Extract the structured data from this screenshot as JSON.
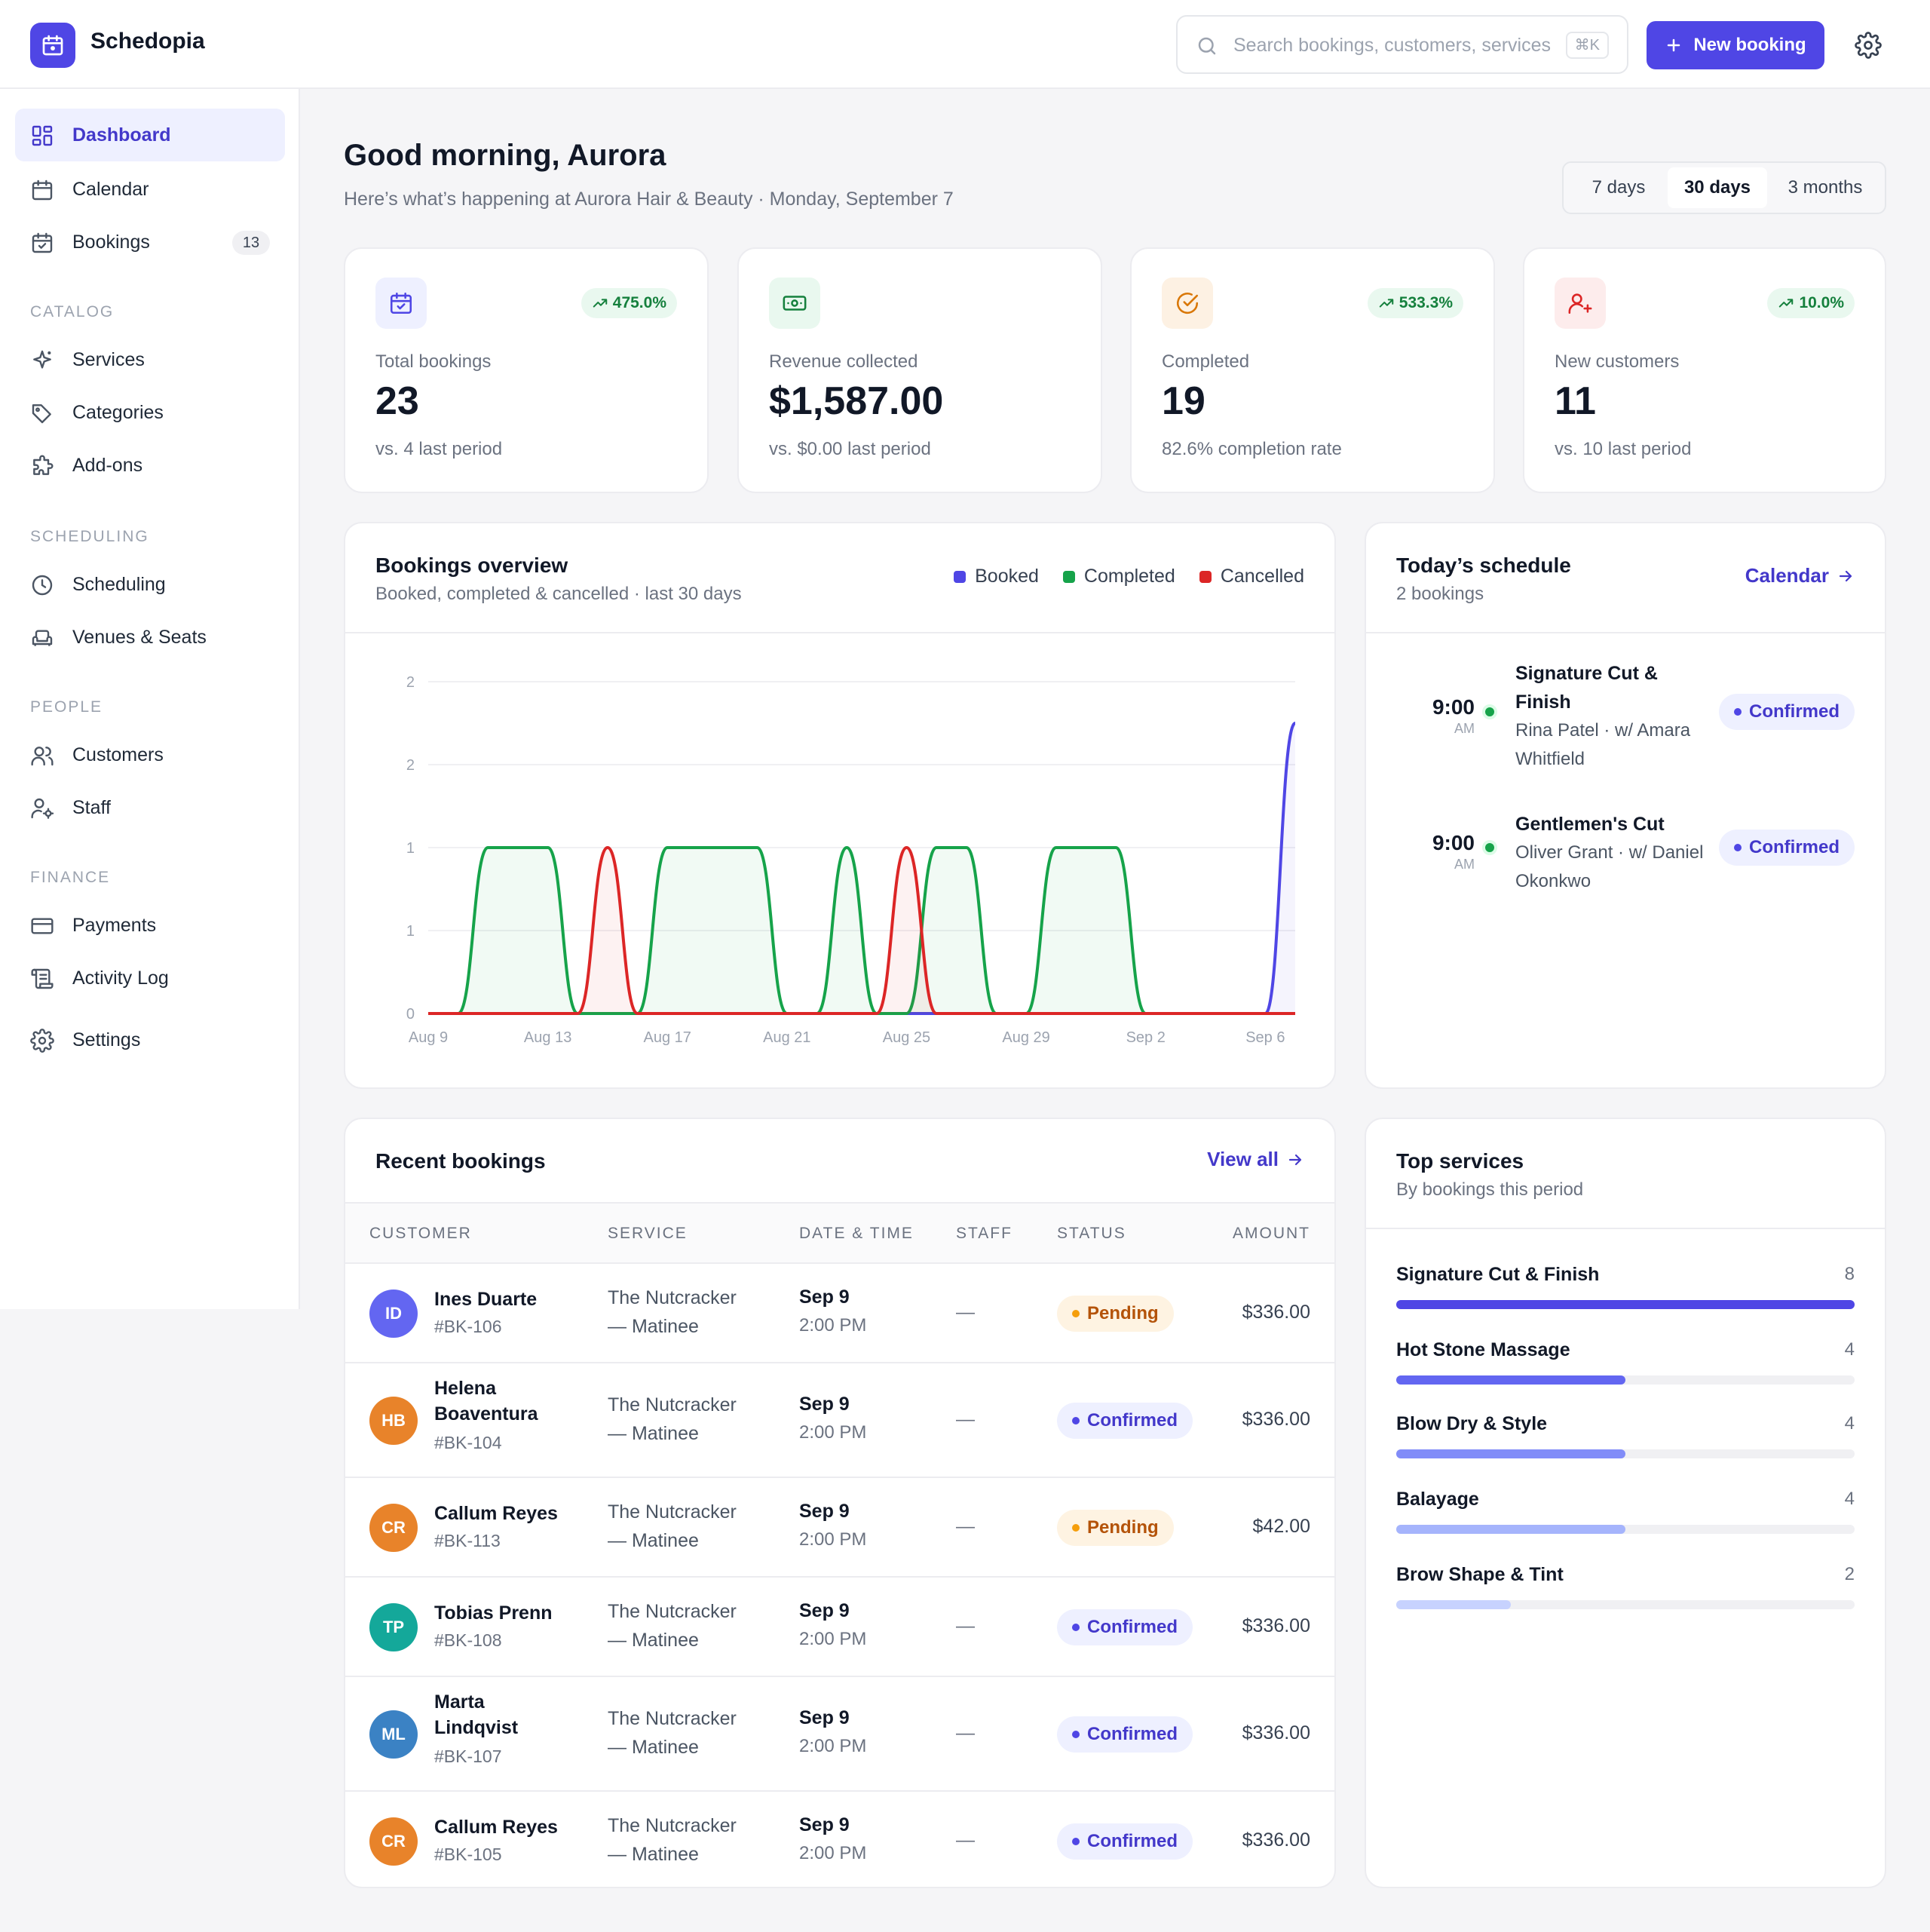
{
  "app": {
    "name": "Schedopia"
  },
  "header": {
    "search_placeholder": "Search bookings, customers, services",
    "shortcut": "⌘K",
    "new_booking": "New booking"
  },
  "sidebar": {
    "items": [
      {
        "label": "Dashboard",
        "icon": "dashboard-icon",
        "active": true
      },
      {
        "label": "Calendar",
        "icon": "calendar-icon"
      },
      {
        "label": "Bookings",
        "icon": "bookings-icon",
        "badge": "13"
      }
    ],
    "catalog": {
      "title": "CATALOG",
      "items": [
        {
          "label": "Services",
          "icon": "sparkle-icon"
        },
        {
          "label": "Categories",
          "icon": "tag-icon"
        },
        {
          "label": "Add-ons",
          "icon": "puzzle-icon"
        }
      ]
    },
    "scheduling": {
      "title": "SCHEDULING",
      "items": [
        {
          "label": "Scheduling",
          "icon": "clock-icon"
        },
        {
          "label": "Venues & Seats",
          "icon": "armchair-icon"
        }
      ]
    },
    "people": {
      "title": "PEOPLE",
      "items": [
        {
          "label": "Customers",
          "icon": "users-icon"
        },
        {
          "label": "Staff",
          "icon": "staff-icon"
        }
      ]
    },
    "finance": {
      "title": "FINANCE",
      "items": [
        {
          "label": "Payments",
          "icon": "credit-card-icon"
        },
        {
          "label": "Activity Log",
          "icon": "scroll-icon"
        }
      ]
    },
    "settings": {
      "label": "Settings",
      "icon": "gear-icon"
    }
  },
  "page": {
    "greeting": "Good morning, Aurora",
    "subtitle": "Here’s what’s happening at Aurora Hair & Beauty · Monday, September 7"
  },
  "range": {
    "options": [
      "7 days",
      "30 days",
      "3 months"
    ],
    "selected": "30 days"
  },
  "kpis": [
    {
      "label": "Total bookings",
      "value": "23",
      "sub": "vs. 4 last period",
      "trend": "475.0%",
      "icon": "calendar-check-icon",
      "icon_bg": "#eef0ff",
      "icon_color": "#4f46e5"
    },
    {
      "label": "Revenue collected",
      "value": "$1,587.00",
      "sub": "vs. $0.00 last period",
      "icon": "banknote-icon",
      "icon_bg": "#e9f8ef",
      "icon_color": "#15803d"
    },
    {
      "label": "Completed",
      "value": "19",
      "sub": "82.6% completion rate",
      "trend": "533.3%",
      "icon": "check-circle-icon",
      "icon_bg": "#fdf1e3",
      "icon_color": "#d97706"
    },
    {
      "label": "New customers",
      "value": "11",
      "sub": "vs. 10 last period",
      "trend": "10.0%",
      "icon": "user-plus-icon",
      "icon_bg": "#fdecec",
      "icon_color": "#dc2626"
    }
  ],
  "overview": {
    "title": "Bookings overview",
    "subtitle": "Booked, completed & cancelled · last 30 days",
    "legend": [
      {
        "name": "Booked",
        "color": "#4f46e5"
      },
      {
        "name": "Completed",
        "color": "#16a34a"
      },
      {
        "name": "Cancelled",
        "color": "#dc2626"
      }
    ]
  },
  "chart_data": {
    "type": "area",
    "x": [
      "Aug 9",
      "Aug 10",
      "Aug 11",
      "Aug 12",
      "Aug 13",
      "Aug 14",
      "Aug 15",
      "Aug 16",
      "Aug 17",
      "Aug 18",
      "Aug 19",
      "Aug 20",
      "Aug 21",
      "Aug 22",
      "Aug 23",
      "Aug 24",
      "Aug 25",
      "Aug 26",
      "Aug 27",
      "Aug 28",
      "Aug 29",
      "Aug 30",
      "Aug 31",
      "Sep 1",
      "Sep 2",
      "Sep 3",
      "Sep 4",
      "Sep 5",
      "Sep 6",
      "Sep 7"
    ],
    "x_ticks": [
      "Aug 9",
      "Aug 13",
      "Aug 17",
      "Aug 21",
      "Aug 25",
      "Aug 29",
      "Sep 2",
      "Sep 6"
    ],
    "y_ticks": [
      "0",
      "1",
      "1",
      "2",
      "2"
    ],
    "ylim": [
      0,
      2
    ],
    "series": [
      {
        "name": "Booked",
        "color": "#4f46e5",
        "values": [
          0,
          0,
          0,
          0,
          0,
          0,
          0,
          0,
          0,
          0,
          0,
          0,
          0,
          0,
          0,
          0,
          0,
          0,
          0,
          0,
          0,
          0,
          0,
          0,
          0,
          0,
          0,
          0,
          0,
          1.75
        ]
      },
      {
        "name": "Completed",
        "color": "#16a34a",
        "values": [
          0,
          0,
          1,
          1,
          1,
          0,
          0,
          0,
          1,
          1,
          1,
          1,
          0,
          0,
          1,
          0,
          0,
          1,
          1,
          0,
          0,
          1,
          1,
          1,
          0,
          0,
          0,
          0,
          0,
          0
        ]
      },
      {
        "name": "Cancelled",
        "color": "#dc2626",
        "values": [
          0,
          0,
          0,
          0,
          0,
          0,
          1,
          0,
          0,
          0,
          0,
          0,
          0,
          0,
          0,
          0,
          1,
          0,
          0,
          0,
          0,
          0,
          0,
          0,
          0,
          0,
          0,
          0,
          0,
          0
        ]
      }
    ]
  },
  "schedule": {
    "title": "Today’s schedule",
    "subtitle": "2 bookings",
    "link": "Calendar",
    "items": [
      {
        "time": "9:00",
        "ampm": "AM",
        "service": "Signature Cut & Finish",
        "who": "Rina Patel · w/ Amara Whitfield",
        "status": "Confirmed"
      },
      {
        "time": "9:00",
        "ampm": "AM",
        "service": "Gentlemen's Cut",
        "who": "Oliver Grant · w/ Daniel Okonkwo",
        "status": "Confirmed"
      }
    ]
  },
  "recent": {
    "title": "Recent bookings",
    "link": "View all",
    "columns": [
      "CUSTOMER",
      "SERVICE",
      "DATE & TIME",
      "STAFF",
      "STATUS",
      "AMOUNT"
    ],
    "rows": [
      {
        "initials": "ID",
        "color": "#6366f1",
        "name": "Ines Duarte",
        "id": "#BK-106",
        "service": "The Nutcracker — Matinee",
        "date": "Sep 9",
        "time": "2:00 PM",
        "staff": "—",
        "status": "Pending",
        "amount": "$336.00"
      },
      {
        "initials": "HB",
        "color": "#e8832a",
        "name": "Helena Boaventura",
        "id": "#BK-104",
        "service": "The Nutcracker — Matinee",
        "date": "Sep 9",
        "time": "2:00 PM",
        "staff": "—",
        "status": "Confirmed",
        "amount": "$336.00"
      },
      {
        "initials": "CR",
        "color": "#e8832a",
        "name": "Callum Reyes",
        "id": "#BK-113",
        "service": "The Nutcracker — Matinee",
        "date": "Sep 9",
        "time": "2:00 PM",
        "staff": "—",
        "status": "Pending",
        "amount": "$42.00"
      },
      {
        "initials": "TP",
        "color": "#14a89a",
        "name": "Tobias Prenn",
        "id": "#BK-108",
        "service": "The Nutcracker — Matinee",
        "date": "Sep 9",
        "time": "2:00 PM",
        "staff": "—",
        "status": "Confirmed",
        "amount": "$336.00"
      },
      {
        "initials": "ML",
        "color": "#3b82c4",
        "name": "Marta Lindqvist",
        "id": "#BK-107",
        "service": "The Nutcracker — Matinee",
        "date": "Sep 9",
        "time": "2:00 PM",
        "staff": "—",
        "status": "Confirmed",
        "amount": "$336.00"
      },
      {
        "initials": "CR",
        "color": "#e8832a",
        "name": "Callum Reyes",
        "id": "#BK-105",
        "service": "The Nutcracker — Matinee",
        "date": "Sep 9",
        "time": "2:00 PM",
        "staff": "—",
        "status": "Confirmed",
        "amount": "$336.00"
      }
    ]
  },
  "top_services": {
    "title": "Top services",
    "subtitle": "By bookings this period",
    "items": [
      {
        "name": "Signature Cut & Finish",
        "count": "8",
        "share": 1.0,
        "color": "#4f46e5"
      },
      {
        "name": "Hot Stone Massage",
        "count": "4",
        "share": 0.5,
        "color": "#6366f1"
      },
      {
        "name": "Blow Dry & Style",
        "count": "4",
        "share": 0.5,
        "color": "#818cf8"
      },
      {
        "name": "Balayage",
        "count": "4",
        "share": 0.5,
        "color": "#a5b4fc"
      },
      {
        "name": "Brow Shape & Tint",
        "count": "2",
        "share": 0.25,
        "color": "#c7d2fe"
      }
    ]
  }
}
